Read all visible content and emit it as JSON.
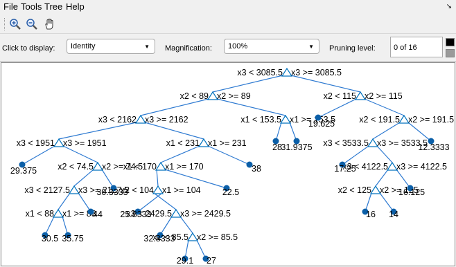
{
  "menu": {
    "items": [
      "File",
      "Tools",
      "Tree",
      "Help"
    ]
  },
  "toolbar": {
    "icons": [
      "zoom-in-icon",
      "zoom-out-icon",
      "pan-hand-icon"
    ]
  },
  "controls": {
    "display_label": "Click to display:",
    "display_value": "Identity",
    "magnification_label": "Magnification:",
    "magnification_value": "100%",
    "pruning_label": "Pruning level:",
    "pruning_value": "0 of 16"
  },
  "tree": {
    "nodes": [
      {
        "id": "n1",
        "left": "x3 < 3085.5",
        "right": "x3 >= 3085.5"
      },
      {
        "id": "n2",
        "left": "x2 < 89",
        "right": "x2 >= 89"
      },
      {
        "id": "n3",
        "left": "x2 < 115",
        "right": "x2 >= 115"
      },
      {
        "id": "n4",
        "left": "x3 < 2162",
        "right": "x3 >= 2162"
      },
      {
        "id": "n5",
        "left": "x1 < 153.5",
        "right": "x1 >= 153.5"
      },
      {
        "id": "n6",
        "left": "x2 < 191.5",
        "right": "x2 >= 191.5"
      },
      {
        "id": "n7",
        "left": "x3 < 1951",
        "right": "x3 >= 1951"
      },
      {
        "id": "n8",
        "left": "x1 < 231",
        "right": "x1 >= 231"
      },
      {
        "id": "n9",
        "left": "x3 < 3533.5",
        "right": "x3 >= 3533.5"
      },
      {
        "id": "n10",
        "left": "x2 < 74.5",
        "right": "x2 >= 74.5"
      },
      {
        "id": "n11",
        "left": "x1 < 170",
        "right": "x1 >= 170"
      },
      {
        "id": "n12",
        "left": "x3 < 4122.5",
        "right": "x3 >= 4122.5"
      },
      {
        "id": "n13",
        "left": "x3 < 2127.5",
        "right": "x3 >= 2127.5"
      },
      {
        "id": "n14",
        "left": "x2 < 104",
        "right": "x1 >= 104"
      },
      {
        "id": "n15",
        "left": "x2 < 125",
        "right": "x2 >= 125"
      },
      {
        "id": "n16",
        "left": "x1 < 88",
        "right": "x1 >= 88"
      },
      {
        "id": "n17",
        "left": "x3 < 2429.5",
        "right": "x3 >= 2429.5"
      },
      {
        "id": "n18",
        "left": "x2 < 85.5",
        "right": "x2 >= 85.5"
      }
    ],
    "leaves": [
      {
        "id": "l1",
        "value": "28"
      },
      {
        "id": "l2",
        "value": "31.9375"
      },
      {
        "id": "l3",
        "value": "19.625"
      },
      {
        "id": "l4",
        "value": "12.3333"
      },
      {
        "id": "l5",
        "value": "29.375"
      },
      {
        "id": "l6",
        "value": "38"
      },
      {
        "id": "l7",
        "value": "17.25"
      },
      {
        "id": "l8",
        "value": "22.5"
      },
      {
        "id": "l9",
        "value": "30.3333"
      },
      {
        "id": "l10",
        "value": "16.125"
      },
      {
        "id": "l11",
        "value": "44"
      },
      {
        "id": "l12",
        "value": "25.8333"
      },
      {
        "id": "l13",
        "value": "16"
      },
      {
        "id": "l14",
        "value": "14"
      },
      {
        "id": "l15",
        "value": "30.5"
      },
      {
        "id": "l16",
        "value": "35.75"
      },
      {
        "id": "l17",
        "value": "32.8333"
      },
      {
        "id": "l18",
        "value": "29.1"
      },
      {
        "id": "l19",
        "value": "27"
      }
    ]
  },
  "colors": {
    "edge": "#2e7ad1",
    "node": "#0072bd",
    "leaf": "#0b5fa8"
  }
}
